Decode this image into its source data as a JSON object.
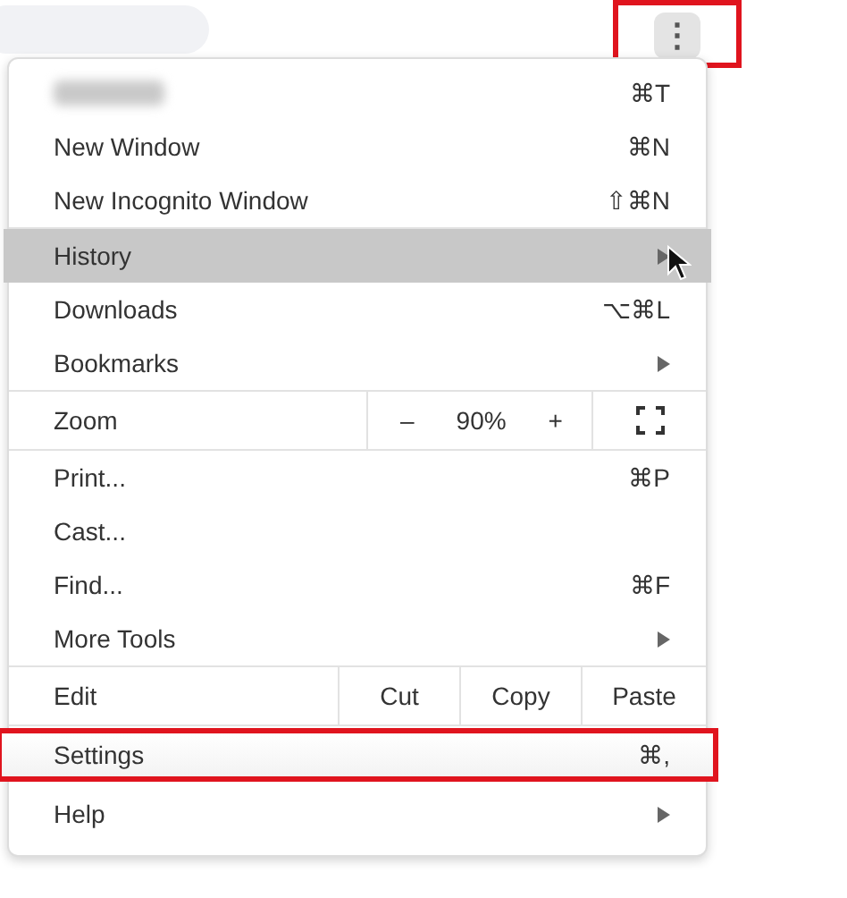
{
  "toolbar": {
    "menu_button": {
      "label": "⋮",
      "outlined": true
    }
  },
  "sections": [
    [
      {
        "kind": "item",
        "blurred": true,
        "shortcut": "⌘T",
        "submenu": false,
        "selected": false,
        "outlined": false
      },
      {
        "kind": "item",
        "label": "New Window",
        "shortcut": "⌘N",
        "submenu": false,
        "selected": false,
        "outlined": false
      },
      {
        "kind": "item",
        "label": "New Incognito Window",
        "shortcut": "⇧⌘N",
        "submenu": false,
        "selected": false,
        "outlined": false
      }
    ],
    [
      {
        "kind": "item",
        "label": "History",
        "submenu": true,
        "selected": true,
        "outlined": false,
        "cursor": true
      },
      {
        "kind": "item",
        "label": "Downloads",
        "shortcut": "⌥⌘L",
        "submenu": false,
        "selected": false,
        "outlined": false
      },
      {
        "kind": "item",
        "label": "Bookmarks",
        "submenu": true,
        "selected": false,
        "outlined": false
      }
    ],
    [
      {
        "kind": "zoom",
        "label": "Zoom",
        "minus": "–",
        "value": "90%",
        "plus": "+"
      }
    ],
    [
      {
        "kind": "item",
        "label": "Print...",
        "shortcut": "⌘P",
        "submenu": false,
        "selected": false,
        "outlined": false
      },
      {
        "kind": "item",
        "label": "Cast...",
        "submenu": false,
        "selected": false,
        "outlined": false
      },
      {
        "kind": "item",
        "label": "Find...",
        "shortcut": "⌘F",
        "submenu": false,
        "selected": false,
        "outlined": false
      },
      {
        "kind": "item",
        "label": "More Tools",
        "submenu": true,
        "selected": false,
        "outlined": false
      }
    ],
    [
      {
        "kind": "edit",
        "label": "Edit",
        "actions": [
          "Cut",
          "Copy",
          "Paste"
        ]
      }
    ],
    [
      {
        "kind": "item",
        "label": "Settings",
        "shortcut": "⌘,",
        "submenu": false,
        "selected": false,
        "outlined": true
      },
      {
        "kind": "item",
        "label": "Help",
        "submenu": true,
        "selected": false,
        "outlined": false
      }
    ]
  ]
}
